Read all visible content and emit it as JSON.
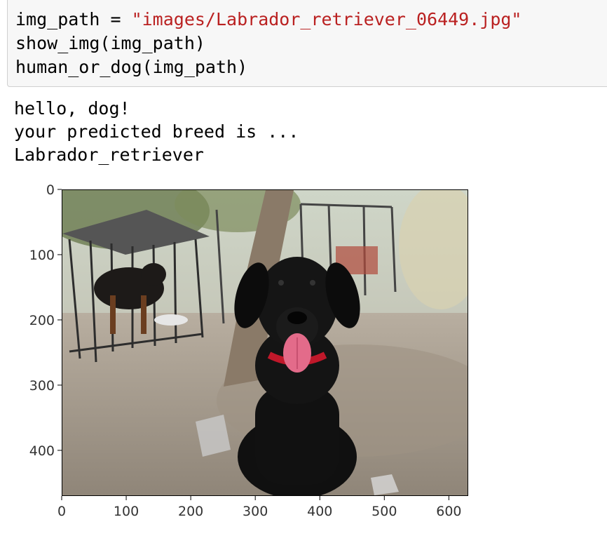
{
  "code_cell": {
    "line1": {
      "var": "img_path",
      "op": " = ",
      "str": "\"images/Labrador_retriever_06449.jpg\""
    },
    "line2": "show_img(img_path)",
    "line3": "human_or_dog(img_path)"
  },
  "output": {
    "line1": "hello, dog!",
    "line2": "your predicted breed is ...",
    "line3": "Labrador_retriever"
  },
  "plot": {
    "y_ticks": [
      "0",
      "100",
      "200",
      "300",
      "400"
    ],
    "x_ticks": [
      "0",
      "100",
      "200",
      "300",
      "400",
      "500",
      "600"
    ]
  },
  "chart_data": {
    "type": "image",
    "x_range": [
      0,
      630
    ],
    "y_range": [
      0,
      470
    ],
    "y_tick_values": [
      0,
      100,
      200,
      300,
      400
    ],
    "x_tick_values": [
      0,
      100,
      200,
      300,
      400,
      500,
      600
    ]
  },
  "colors": {
    "string": "#ba2121",
    "cell_bg": "#f7f7f7",
    "cell_border": "#cfcfcf"
  }
}
